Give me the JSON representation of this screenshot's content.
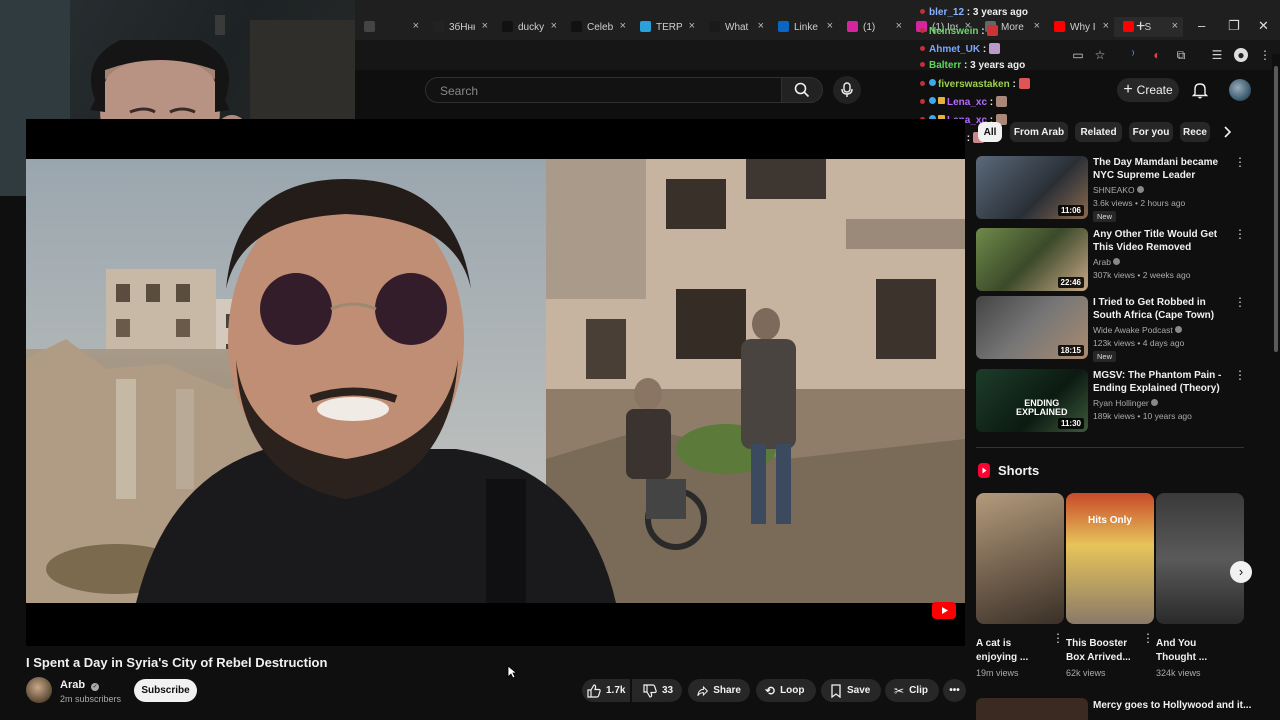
{
  "browser": {
    "tabs": [
      {
        "label": "",
        "icon": "x-icon",
        "color": "#444444"
      },
      {
        "label": "3бНнн",
        "icon": "x-icon",
        "color": "#222222"
      },
      {
        "label": "ducky",
        "icon": "tiktok-icon",
        "color": "#111111"
      },
      {
        "label": "Celeb",
        "icon": "tiktok-icon",
        "color": "#111111"
      },
      {
        "label": "TERPL",
        "icon": "telegram-icon",
        "color": "#2aa1da"
      },
      {
        "label": "What",
        "icon": "chatgpt-icon",
        "color": "#1a1a1a"
      },
      {
        "label": "Linke",
        "icon": "linkedin-icon",
        "color": "#0a66c2"
      },
      {
        "label": "(1)",
        "icon": "instagram-icon",
        "color": "#d6249f"
      },
      {
        "label": "(1) Ins",
        "icon": "instagram-icon",
        "color": "#d6249f"
      },
      {
        "label": "More",
        "icon": "generic-icon",
        "color": "#666666"
      },
      {
        "label": "Why I",
        "icon": "youtube-icon",
        "color": "#ff0000"
      },
      {
        "label": "I S",
        "icon": "youtube-icon",
        "color": "#ff0000",
        "active": true
      }
    ]
  },
  "header": {
    "search_placeholder": "Search",
    "create_label": "Create"
  },
  "chat": [
    {
      "user": "bler_12",
      "text": "3 years ago",
      "color": "#8ab4ff"
    },
    {
      "user": "Neinswein",
      "text": "",
      "color": "#6fd36f"
    },
    {
      "user": "Ahmet_UK",
      "text": "",
      "color": "#7aa7ff"
    },
    {
      "user": "Balterr",
      "text": "3 years ago",
      "color": "#5bd95b"
    },
    {
      "user": "fiverswastaken",
      "text": "",
      "color": "#9fd04a"
    },
    {
      "user": "Lena_xc",
      "text": "",
      "color": "#b66bff"
    },
    {
      "user": "Lena_xc",
      "text": "",
      "color": "#b66bff"
    },
    {
      "user": "Gr4ntie",
      "text": "",
      "color": "#e8e8e8"
    }
  ],
  "video": {
    "title": "I Spent a Day in Syria's City of Rebel Destruction",
    "channel": "Arab",
    "subscribers": "2m subscribers",
    "subscribe_label": "Subscribe",
    "likes": "1.7k",
    "dislikes": "33",
    "share_label": "Share",
    "loop_label": "Loop",
    "save_label": "Save",
    "clip_label": "Clip"
  },
  "chips": [
    "All",
    "From Arab",
    "Related",
    "For you",
    "Rece"
  ],
  "recommendations": [
    {
      "title": "The Day Mamdani became NYC Supreme Leader",
      "channel": "SHNEAKO",
      "meta": "3.6k views • 2 hours ago",
      "duration": "11:06",
      "new": "New"
    },
    {
      "title": "Any Other Title Would Get This Video Removed",
      "channel": "Arab",
      "meta": "307k views • 2 weeks ago",
      "duration": "22:46",
      "new": ""
    },
    {
      "title": "I Tried to Get Robbed in South Africa (Cape Town)",
      "channel": "Wide Awake Podcast",
      "meta": "123k views • 4 days ago",
      "duration": "18:15",
      "new": "New"
    },
    {
      "title": "MGSV: The Phantom Pain - Ending Explained (Theory)",
      "channel": "Ryan Hollinger",
      "meta": "189k views • 10 years ago",
      "duration": "11:30",
      "new": ""
    }
  ],
  "shorts": {
    "heading": "Shorts",
    "items": [
      {
        "title": "A cat is enjoying ...",
        "views": "19m views",
        "overlay": ""
      },
      {
        "title": "This Booster Box Arrived...",
        "views": "62k views",
        "overlay": "Hits Only"
      },
      {
        "title": "And You Thought ...",
        "views": "324k views",
        "overlay": ""
      }
    ]
  },
  "peek_title": "Mercy goes to Hollywood and it..."
}
